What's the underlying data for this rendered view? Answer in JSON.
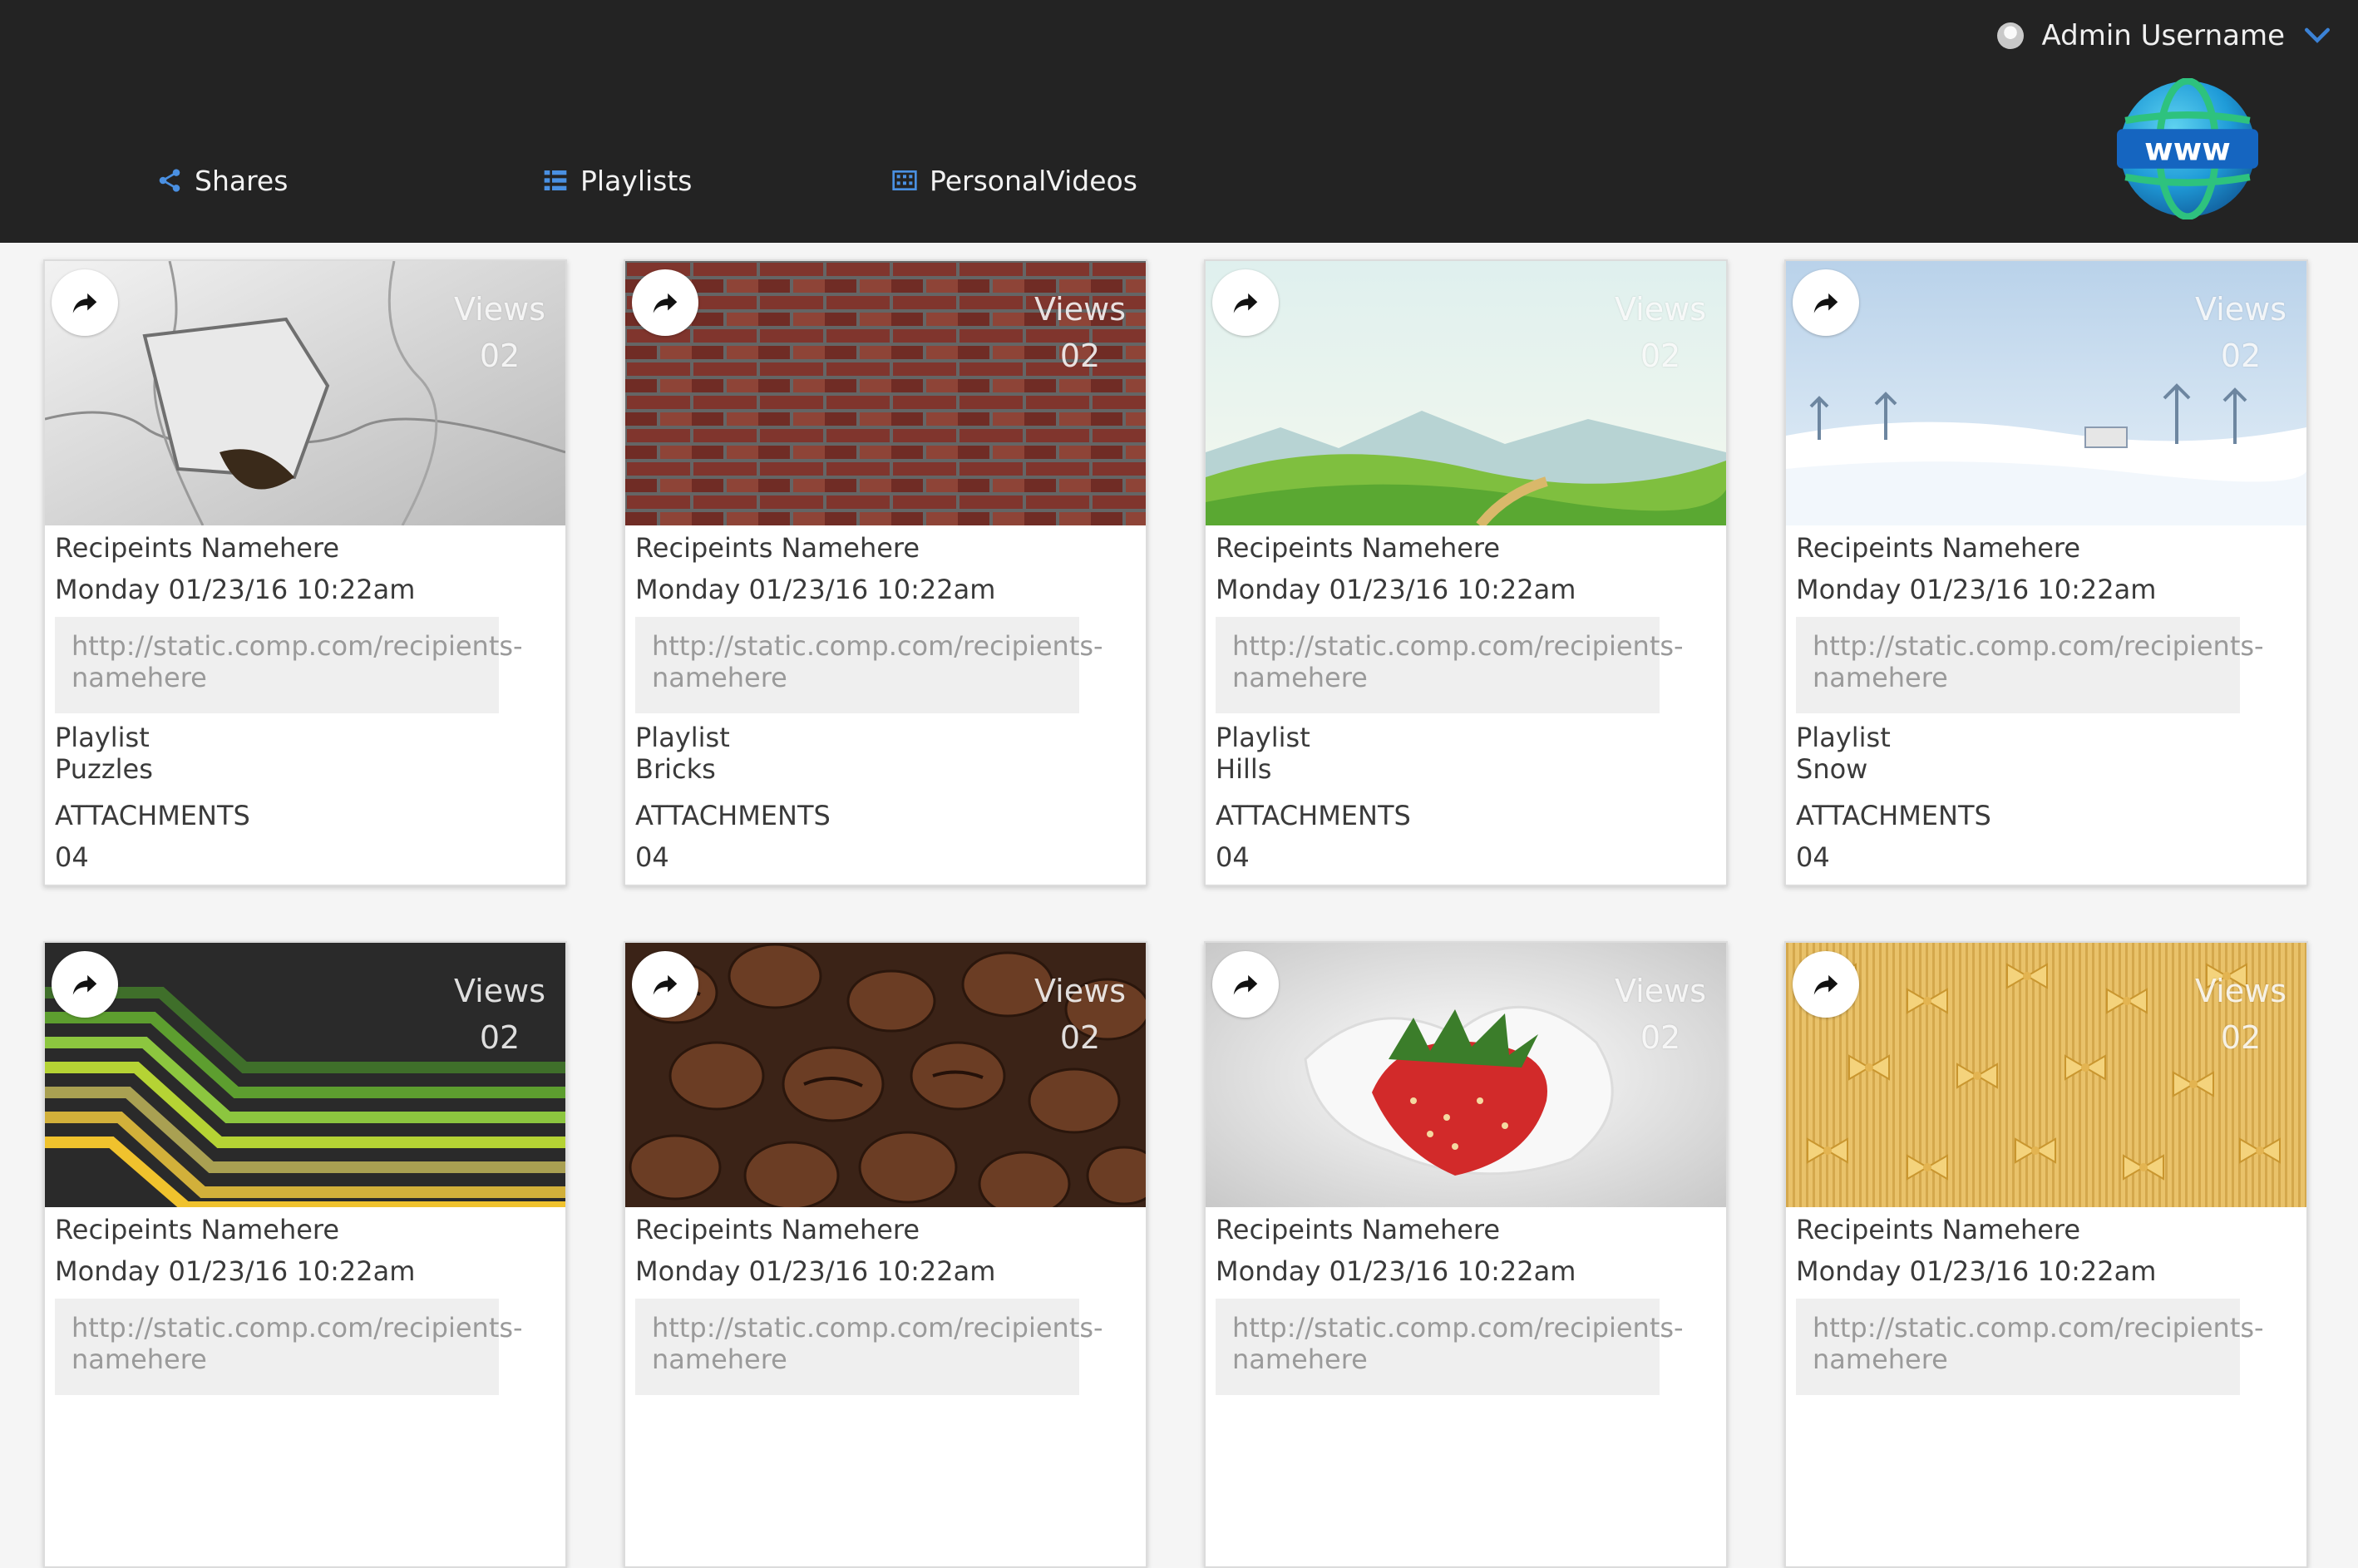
{
  "header": {
    "user_name": "Admin Username",
    "nav": [
      {
        "label": "Shares",
        "icon": "share-icon"
      },
      {
        "label": "Playlists",
        "icon": "list-icon"
      },
      {
        "label": "PersonalVideos",
        "icon": "video-grid-icon"
      }
    ],
    "logo_text": "www"
  },
  "card_labels": {
    "views": "Views",
    "playlist": "Playlist",
    "attachments": "ATTACHMENTS"
  },
  "cards": [
    {
      "name": "Recipeints Namehere",
      "date": "Monday 01/23/16 10:22am",
      "url": "http://static.comp.com/recipients-namehere",
      "views": "02",
      "playlist": "Puzzles",
      "attachments": "04",
      "image": "puzzle"
    },
    {
      "name": "Recipeints Namehere",
      "date": "Monday 01/23/16 10:22am",
      "url": "http://static.comp.com/recipients-namehere",
      "views": "02",
      "playlist": "Bricks",
      "attachments": "04",
      "image": "bricks"
    },
    {
      "name": "Recipeints Namehere",
      "date": "Monday 01/23/16 10:22am",
      "url": "http://static.comp.com/recipients-namehere",
      "views": "02",
      "playlist": "Hills",
      "attachments": "04",
      "image": "hills"
    },
    {
      "name": "Recipeints Namehere",
      "date": "Monday 01/23/16 10:22am",
      "url": "http://static.comp.com/recipients-namehere",
      "views": "02",
      "playlist": "Snow",
      "attachments": "04",
      "image": "snow"
    },
    {
      "name": "Recipeints Namehere",
      "date": "Monday 01/23/16 10:22am",
      "url": "http://static.comp.com/recipients-namehere",
      "views": "02",
      "playlist": "",
      "attachments": "",
      "image": "stripes"
    },
    {
      "name": "Recipeints Namehere",
      "date": "Monday 01/23/16 10:22am",
      "url": "http://static.comp.com/recipients-namehere",
      "views": "02",
      "playlist": "",
      "attachments": "",
      "image": "coffee"
    },
    {
      "name": "Recipeints Namehere",
      "date": "Monday 01/23/16 10:22am",
      "url": "http://static.comp.com/recipients-namehere",
      "views": "02",
      "playlist": "",
      "attachments": "",
      "image": "strawberry"
    },
    {
      "name": "Recipeints Namehere",
      "date": "Monday 01/23/16 10:22am",
      "url": "http://static.comp.com/recipients-namehere",
      "views": "02",
      "playlist": "",
      "attachments": "",
      "image": "pasta"
    }
  ],
  "colors": {
    "topbar": "#232323",
    "nav_icon": "#4a90e2",
    "accent": "#3b82d6"
  }
}
